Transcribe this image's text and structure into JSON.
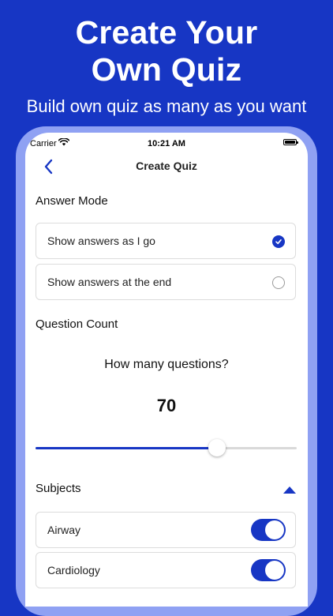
{
  "brand_color": "#1736c4",
  "promo": {
    "headline": "Create Your Own Quiz",
    "subheadline": "Build own quiz as many as you want"
  },
  "status_bar": {
    "carrier": "Carrier",
    "time": "10:21 AM"
  },
  "nav": {
    "title": "Create Quiz",
    "back_icon": "chevron-left-icon"
  },
  "answer_mode": {
    "label": "Answer Mode",
    "options": [
      {
        "label": "Show answers as I go",
        "selected": true
      },
      {
        "label": "Show answers at the end",
        "selected": false
      }
    ]
  },
  "question_count": {
    "label": "Question Count",
    "prompt": "How many questions?",
    "value": "70",
    "slider_fraction": 0.695
  },
  "subjects": {
    "label": "Subjects",
    "collapse_icon": "caret-up-icon",
    "items": [
      {
        "label": "Airway",
        "enabled": true
      },
      {
        "label": "Cardiology",
        "enabled": true
      }
    ]
  }
}
